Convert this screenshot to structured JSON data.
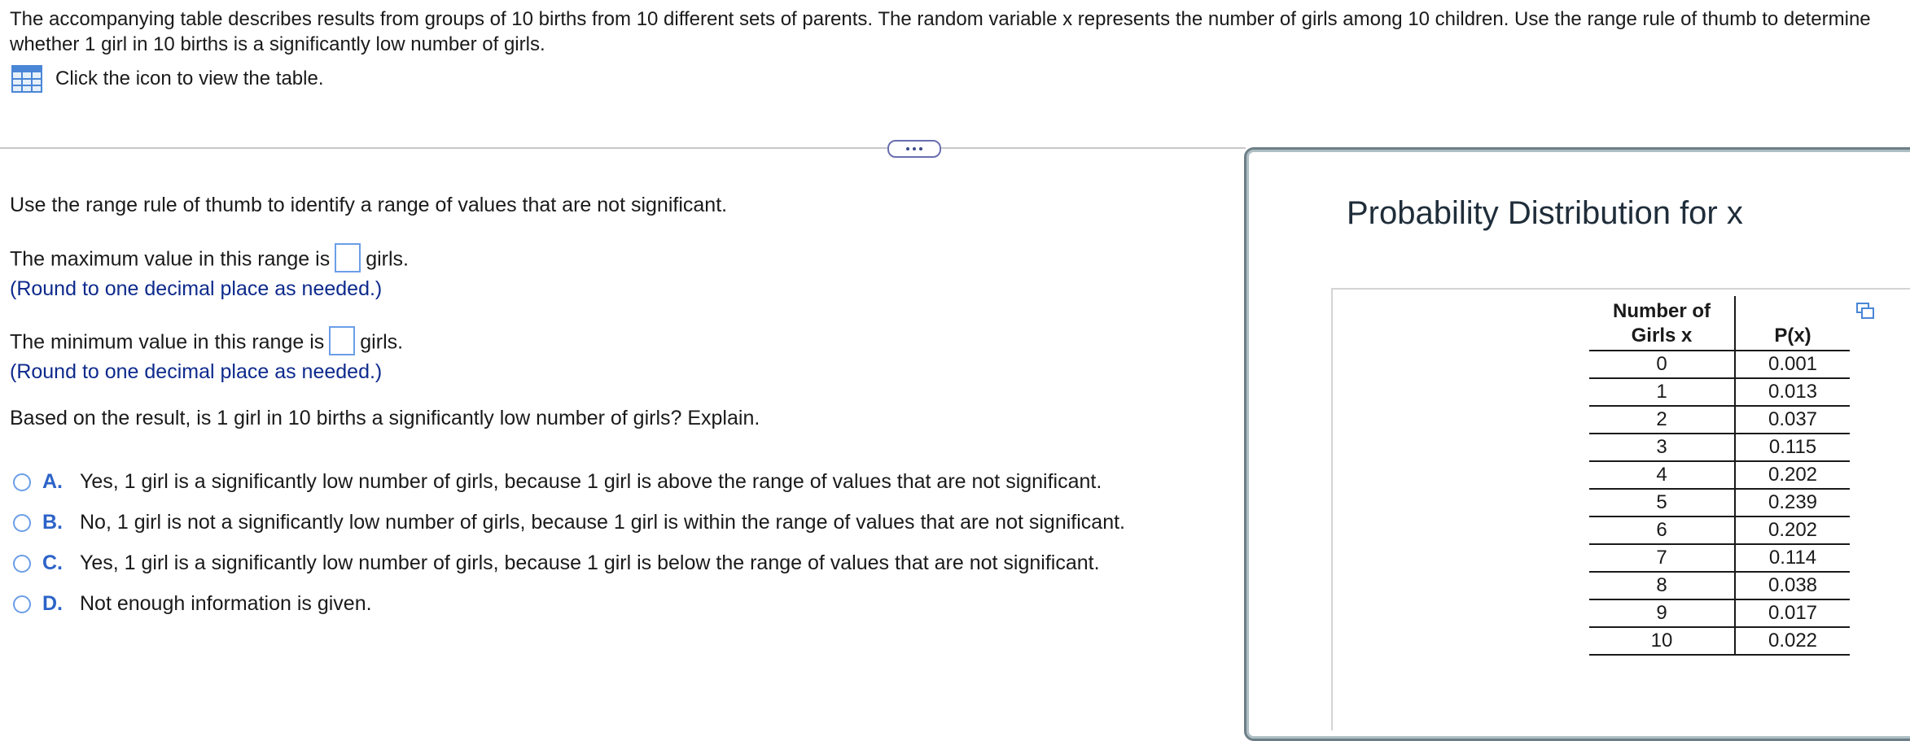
{
  "question": {
    "text": "The accompanying table describes results from groups of 10 births from 10 different sets of parents. The random variable x represents the number of girls among 10 children. Use the range rule of thumb to determine whether 1 girl in 10 births is a significantly low number of girls.",
    "table_link_label": "Click the icon to view the table."
  },
  "main": {
    "instruction": "Use the range rule of thumb to identify a range of values that are not significant.",
    "max_prefix": "The maximum value in this range is",
    "max_suffix": "girls.",
    "max_hint": "(Round to one decimal place as needed.)",
    "min_prefix": "The minimum value in this range is",
    "min_suffix": "girls.",
    "min_hint": "(Round to one decimal place as needed.)",
    "prompt": "Based on the result, is 1 girl in 10 births a significantly low number of girls? Explain.",
    "options": [
      {
        "letter": "A.",
        "text": "Yes, 1 girl is a significantly low number of girls, because 1 girl is above the range of values that are not significant."
      },
      {
        "letter": "B.",
        "text": "No, 1 girl is not a significantly low number of girls, because 1 girl is within the range of values that are not significant."
      },
      {
        "letter": "C.",
        "text": "Yes, 1 girl is a significantly low number of girls, because 1 girl is below the range of values that are not significant."
      },
      {
        "letter": "D.",
        "text": "Not enough information is given."
      }
    ]
  },
  "panel": {
    "title": "Probability Distribution for x",
    "header_x_line1": "Number of",
    "header_x_line2": "Girls x",
    "header_p": "P(x)",
    "rows": [
      {
        "x": "0",
        "p": "0.001"
      },
      {
        "x": "1",
        "p": "0.013"
      },
      {
        "x": "2",
        "p": "0.037"
      },
      {
        "x": "3",
        "p": "0.115"
      },
      {
        "x": "4",
        "p": "0.202"
      },
      {
        "x": "5",
        "p": "0.239"
      },
      {
        "x": "6",
        "p": "0.202"
      },
      {
        "x": "7",
        "p": "0.114"
      },
      {
        "x": "8",
        "p": "0.038"
      },
      {
        "x": "9",
        "p": "0.017"
      },
      {
        "x": "10",
        "p": "0.022"
      }
    ]
  },
  "colors": {
    "accent": "#2c63c8",
    "hint": "#0d2a8c",
    "input_border": "#6b9ee8"
  },
  "icons": [
    "table-icon",
    "more-icon",
    "copy-icon"
  ]
}
